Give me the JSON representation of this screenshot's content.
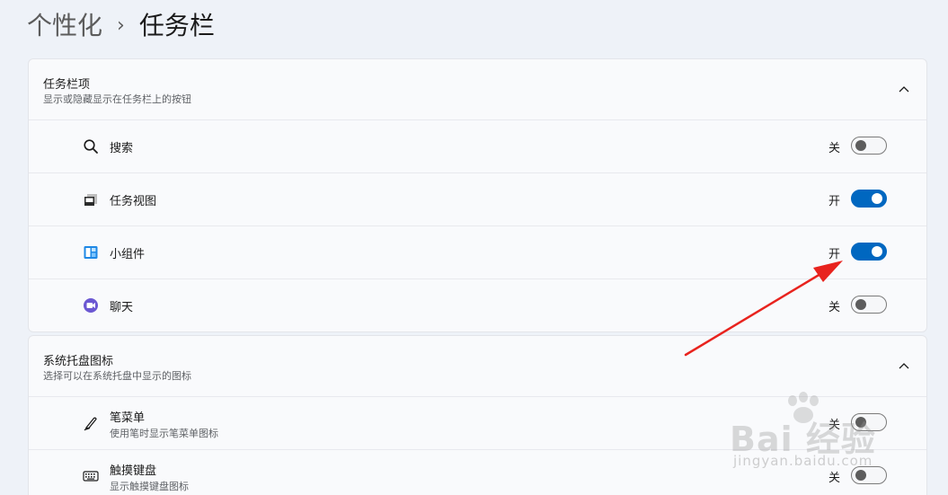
{
  "breadcrumb": {
    "parent": "个性化",
    "separator": "›",
    "current": "任务栏"
  },
  "taskbar_items": {
    "title": "任务栏项",
    "subtitle": "显示或隐藏显示在任务栏上的按钮",
    "items": [
      {
        "icon": "search-icon",
        "label": "搜索",
        "state": "关",
        "on": false
      },
      {
        "icon": "task-view-icon",
        "label": "任务视图",
        "state": "开",
        "on": true
      },
      {
        "icon": "widgets-icon",
        "label": "小组件",
        "state": "开",
        "on": true
      },
      {
        "icon": "chat-icon",
        "label": "聊天",
        "state": "关",
        "on": false
      }
    ]
  },
  "system_tray": {
    "title": "系统托盘图标",
    "subtitle": "选择可以在系统托盘中显示的图标",
    "items": [
      {
        "icon": "pen-icon",
        "label": "笔菜单",
        "sub": "使用笔时显示笔菜单图标",
        "state": "关",
        "on": false
      },
      {
        "icon": "keyboard-icon",
        "label": "触摸键盘",
        "sub": "显示触摸键盘图标",
        "state": "关",
        "on": false
      }
    ]
  },
  "watermark": {
    "main": "Bai 经验",
    "sub": "jingyan.baidu.com"
  },
  "colors": {
    "accent": "#0067c0",
    "annotation_arrow": "#e8231e",
    "background": "#eef2f8"
  }
}
